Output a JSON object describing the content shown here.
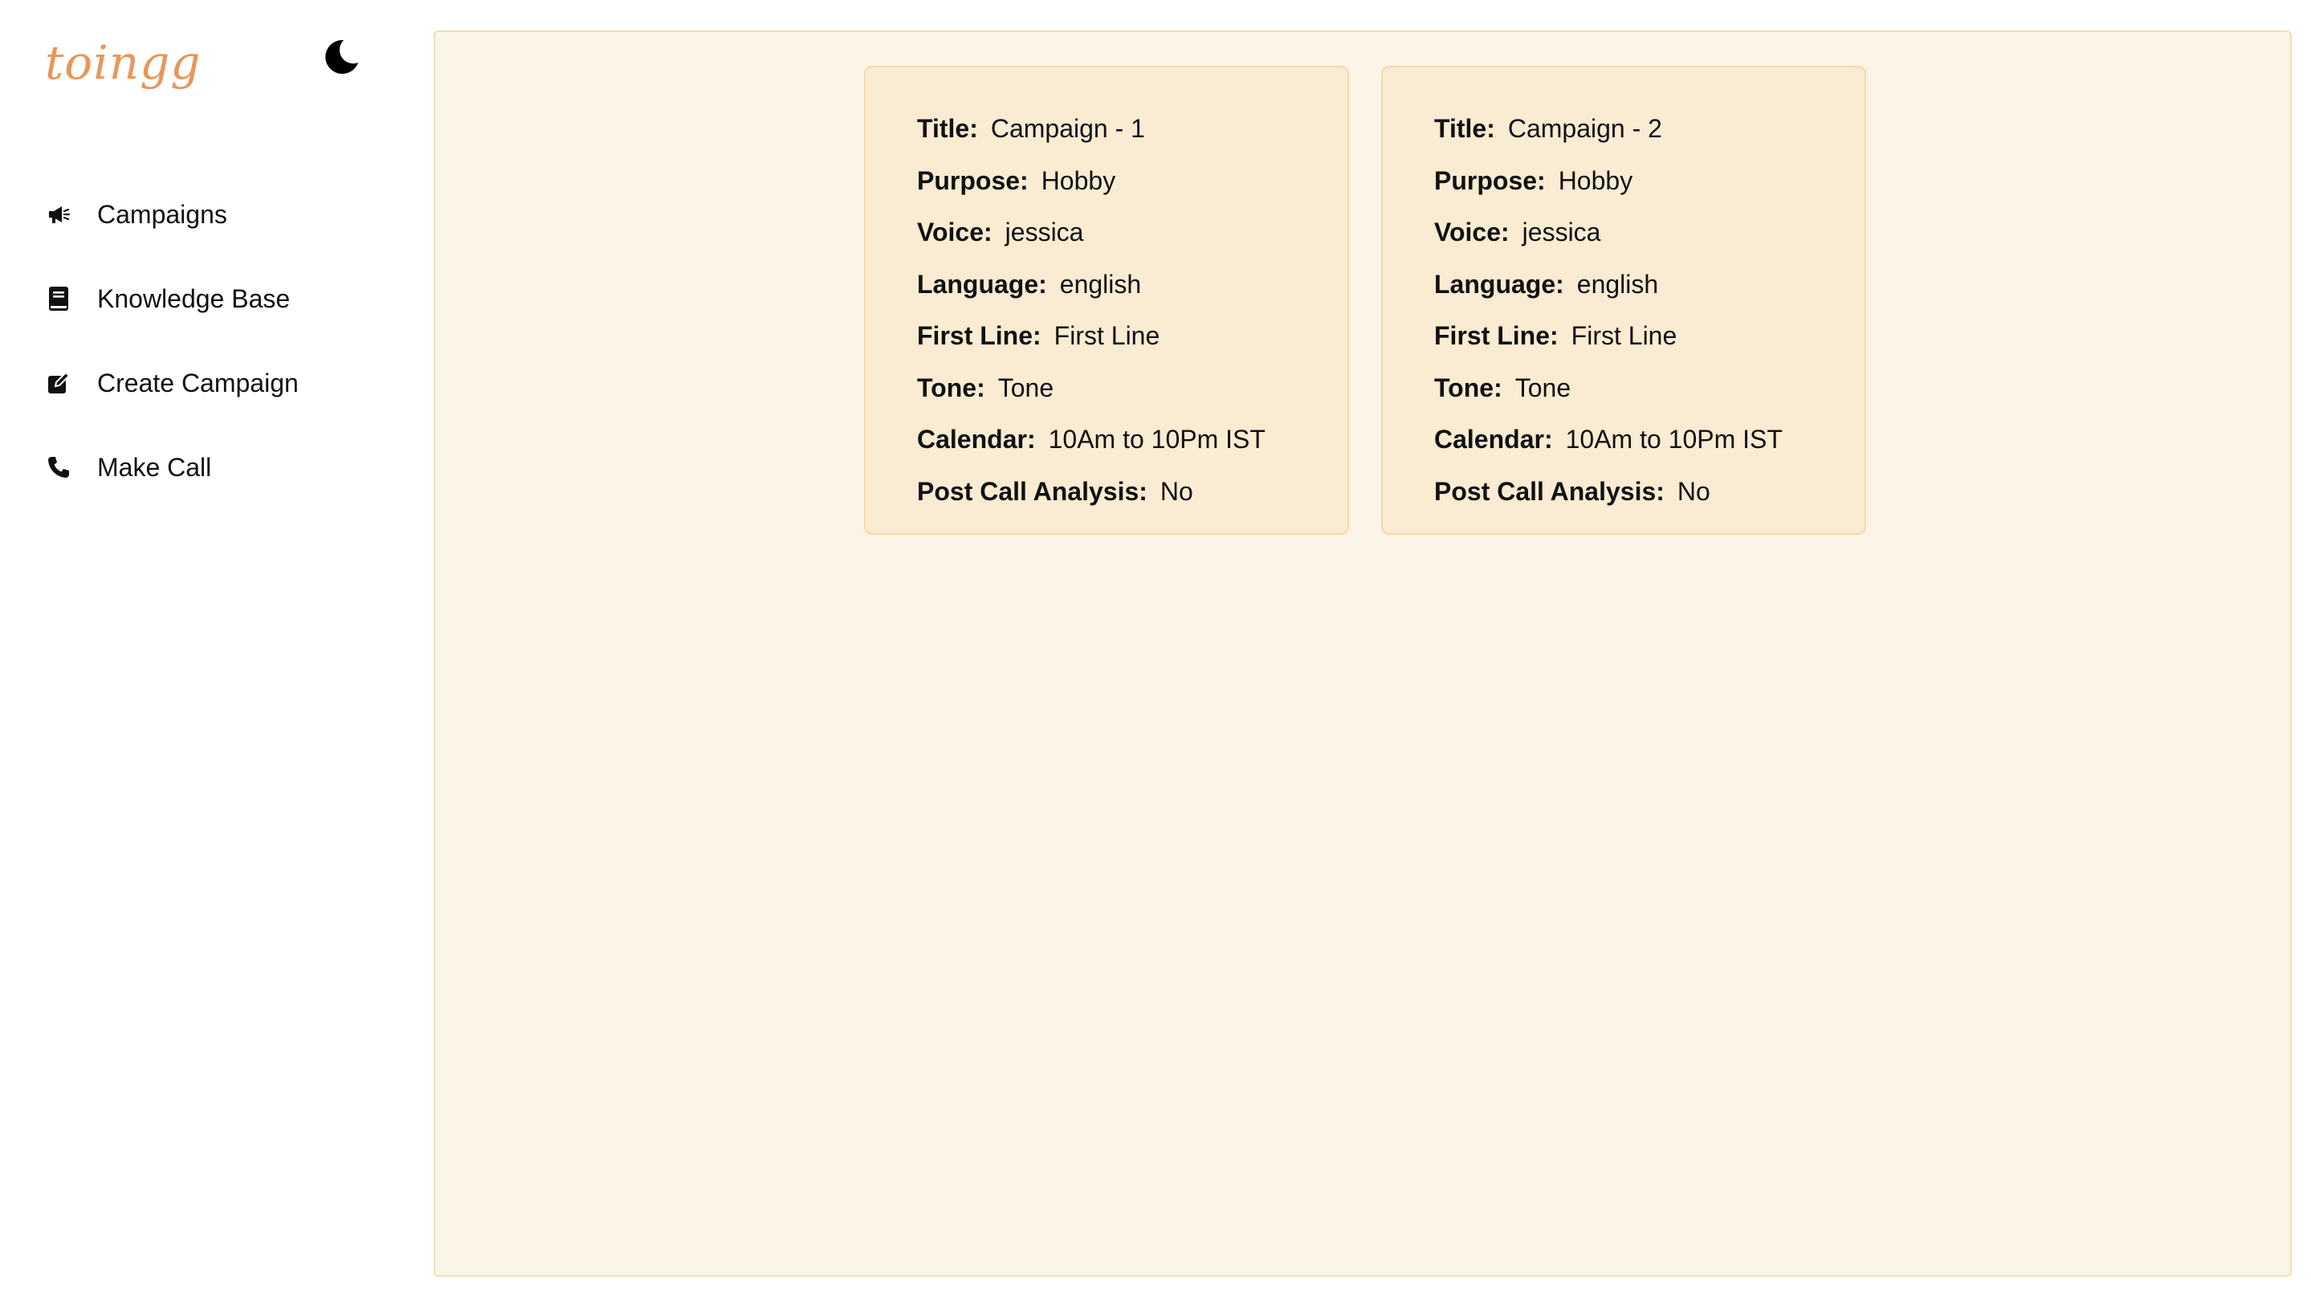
{
  "app": {
    "logo_text": "toingg",
    "brand_color": "#e8975a",
    "theme_toggle_icon": "moon-icon"
  },
  "sidebar": {
    "items": [
      {
        "label": "Campaigns",
        "icon": "megaphone-icon"
      },
      {
        "label": "Knowledge Base",
        "icon": "book-icon"
      },
      {
        "label": "Create Campaign",
        "icon": "edit-icon"
      },
      {
        "label": "Make Call",
        "icon": "phone-icon"
      }
    ]
  },
  "campaigns": [
    {
      "title_label": "Title:",
      "title": "Campaign - 1",
      "purpose_label": "Purpose:",
      "purpose": "Hobby",
      "voice_label": "Voice:",
      "voice": "jessica",
      "language_label": "Language:",
      "language": "english",
      "first_line_label": "First Line:",
      "first_line": "First Line",
      "tone_label": "Tone:",
      "tone": "Tone",
      "calendar_label": "Calendar:",
      "calendar": "10Am to 10Pm IST",
      "post_call_label": "Post Call Analysis:",
      "post_call": "No"
    },
    {
      "title_label": "Title:",
      "title": "Campaign - 2",
      "purpose_label": "Purpose:",
      "purpose": "Hobby",
      "voice_label": "Voice:",
      "voice": "jessica",
      "language_label": "Language:",
      "language": "english",
      "first_line_label": "First Line:",
      "first_line": "First Line",
      "tone_label": "Tone:",
      "tone": "Tone",
      "calendar_label": "Calendar:",
      "calendar": "10Am to 10Pm IST",
      "post_call_label": "Post Call Analysis:",
      "post_call": "No"
    }
  ],
  "colors": {
    "main_bg": "#fcf4e7",
    "card_bg": "#faebd3",
    "border": "#f6dcb1"
  }
}
